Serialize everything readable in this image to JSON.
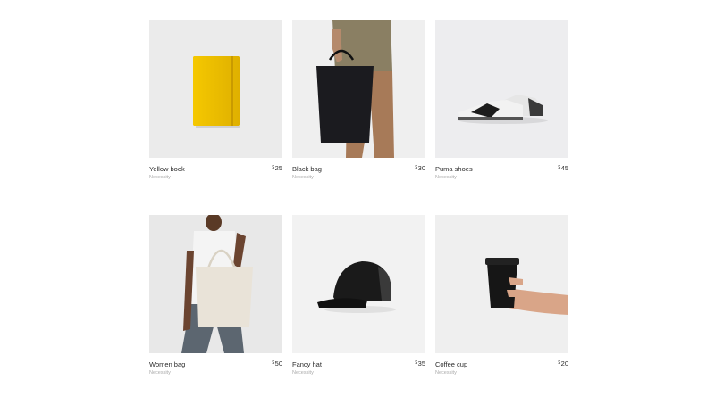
{
  "currency_symbol": "$",
  "products": [
    {
      "name": "Yellow book",
      "category": "Necessity",
      "price": "25",
      "image_icon": "yellow-notebook-icon"
    },
    {
      "name": "Black bag",
      "category": "Necessity",
      "price": "30",
      "image_icon": "black-tote-bag-icon"
    },
    {
      "name": "Puma shoes",
      "category": "Necessity",
      "price": "45",
      "image_icon": "sneakers-icon"
    },
    {
      "name": "Women bag",
      "category": "Necessity",
      "price": "50",
      "image_icon": "canvas-tote-bag-icon"
    },
    {
      "name": "Fancy hat",
      "category": "Necessity",
      "price": "35",
      "image_icon": "black-cap-icon"
    },
    {
      "name": "Coffee cup",
      "category": "Necessity",
      "price": "20",
      "image_icon": "coffee-cup-icon"
    }
  ],
  "colors": {
    "image_bg": "#ececec",
    "text": "#2b2b2b",
    "muted": "#a9a9a9"
  }
}
